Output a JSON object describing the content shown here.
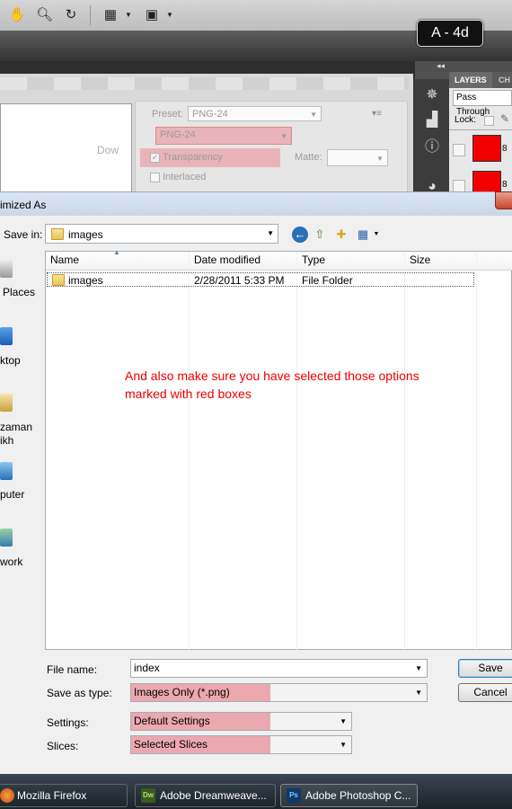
{
  "photoshop": {
    "badge": "A - 4d",
    "layers_tab": "LAYERS",
    "channels_tab": "CH",
    "blend_mode": "Pass Through",
    "lock_label": "Lock:"
  },
  "save_for_web": {
    "preview_text": "Dow",
    "preset_label": "Preset:",
    "preset_value": "PNG-24",
    "format_value": "PNG-24",
    "transparency_label": "Transparency",
    "matte_label": "Matte:",
    "interlaced_label": "Interlaced"
  },
  "dialog": {
    "title": "imized As",
    "save_in_label": "Save in:",
    "save_in_value": "images",
    "places": {
      "recent": "Places",
      "desktop": "ktop",
      "user_line1": "zaman",
      "user_line2": "ikh",
      "computer": "puter",
      "network": "work"
    },
    "columns": {
      "name": "Name",
      "date": "Date modified",
      "type": "Type",
      "size": "Size"
    },
    "rows": [
      {
        "name": "images",
        "date": "2/28/2011 5:33 PM",
        "type": "File Folder",
        "size": ""
      }
    ],
    "annotation_line1": "And also make sure you have selected those options",
    "annotation_line2": "marked with red boxes",
    "file_name_label": "File name:",
    "file_name_value": "index",
    "save_type_label": "Save as type:",
    "save_type_value": "Images Only (*.png)",
    "settings_label": "Settings:",
    "settings_value": "Default Settings",
    "slices_label": "Slices:",
    "slices_value": "Selected Slices",
    "save_button": "Save",
    "cancel_button": "Cancel"
  },
  "taskbar": {
    "items": [
      {
        "label": "Mozilla Firefox",
        "icon": "firefox-icon"
      },
      {
        "label": "Adobe Dreamweave...",
        "icon": "dreamweaver-icon"
      },
      {
        "label": "Adobe Photoshop C...",
        "icon": "photoshop-icon"
      }
    ]
  },
  "colors": {
    "highlight_red": "#eb7882",
    "annotation_red": "#e00000",
    "layer_thumb": "#f20000"
  }
}
